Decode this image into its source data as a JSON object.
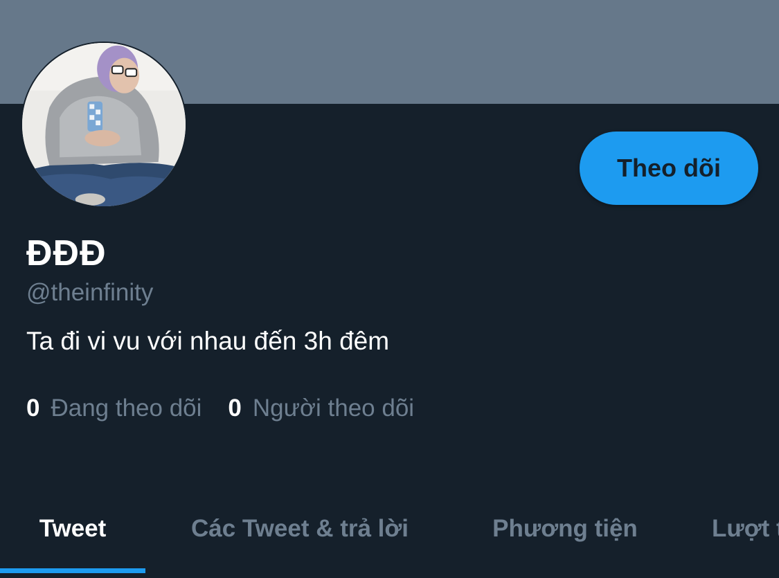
{
  "profile": {
    "display_name": "ĐĐĐ",
    "handle": "@theinfinity",
    "bio": "Ta đi vi vu với nhau đến 3h đêm",
    "follow_label": "Theo dõi"
  },
  "stats": [
    {
      "count": "0",
      "label": "Đang theo dõi"
    },
    {
      "count": "0",
      "label": "Người theo dõi"
    }
  ],
  "tabs": [
    {
      "label": "Tweet"
    },
    {
      "label": "Các Tweet & trả lời"
    },
    {
      "label": "Phương tiện"
    },
    {
      "label": "Lượt thích"
    }
  ],
  "colors": {
    "background": "#15202b",
    "banner": "#66788a",
    "accent": "#1d9bf0",
    "secondary_text": "#6e7f90"
  },
  "icons": {
    "avatar": "profile-photo"
  }
}
